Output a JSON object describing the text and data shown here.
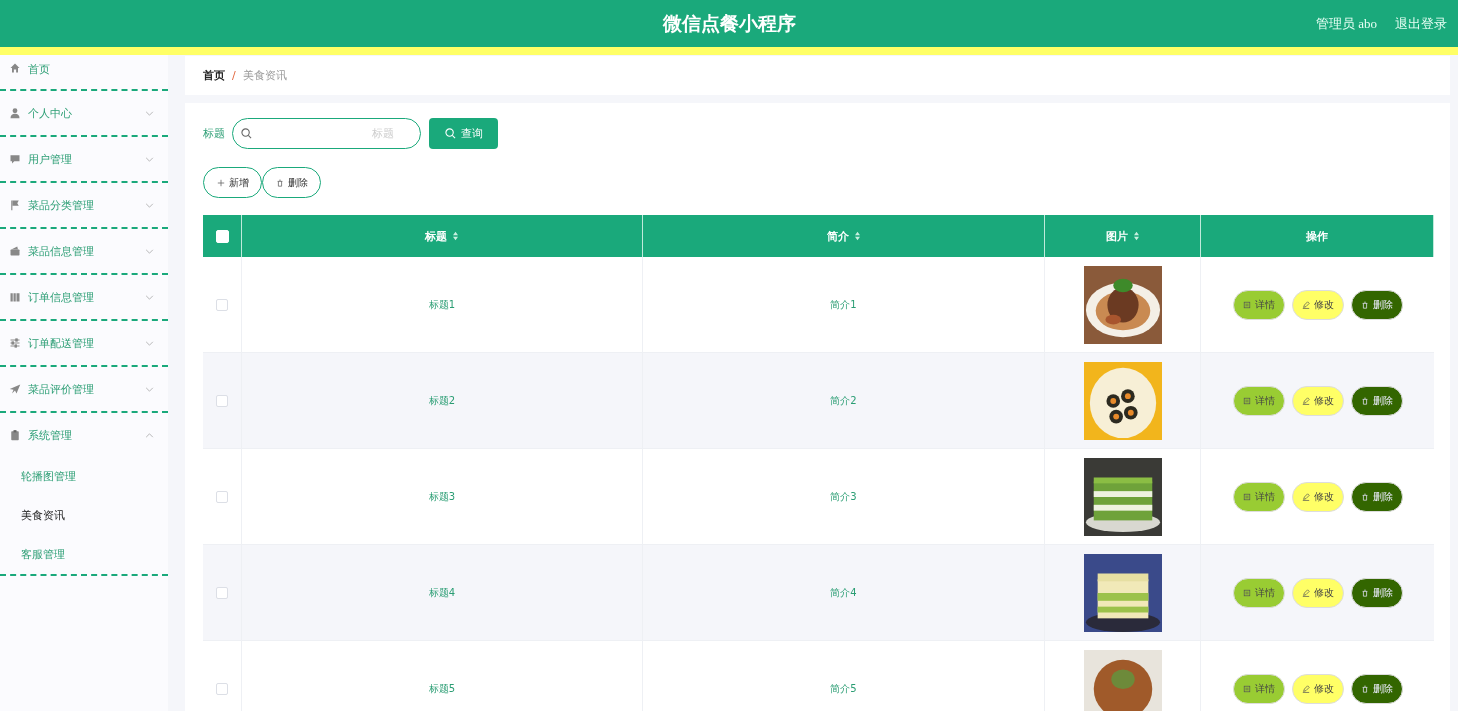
{
  "header": {
    "title": "微信点餐小程序",
    "user": "管理员 abo",
    "logout": "退出登录"
  },
  "sidebar": {
    "items": [
      {
        "label": "首页",
        "kind": "link"
      },
      {
        "label": "个人中心",
        "kind": "menu",
        "expanded": false
      },
      {
        "label": "用户管理",
        "kind": "menu",
        "expanded": false
      },
      {
        "label": "菜品分类管理",
        "kind": "menu",
        "expanded": false
      },
      {
        "label": "菜品信息管理",
        "kind": "menu",
        "expanded": false
      },
      {
        "label": "订单信息管理",
        "kind": "menu",
        "expanded": false
      },
      {
        "label": "订单配送管理",
        "kind": "menu",
        "expanded": false
      },
      {
        "label": "菜品评价管理",
        "kind": "menu",
        "expanded": false
      },
      {
        "label": "系统管理",
        "kind": "menu",
        "expanded": true,
        "children": [
          {
            "label": "轮播图管理",
            "selected": false
          },
          {
            "label": "美食资讯",
            "selected": true
          },
          {
            "label": "客服管理",
            "selected": false
          }
        ]
      }
    ]
  },
  "breadcrumb": {
    "items": [
      "首页",
      "美食资讯"
    ],
    "separator": "/"
  },
  "search": {
    "label": "标题",
    "placeholder": "标题",
    "button": "查询"
  },
  "actions": [
    "新增",
    "删除"
  ],
  "table": {
    "select_all_checked": false,
    "columns": [
      {
        "label": "标题",
        "sortable": true
      },
      {
        "label": "简介",
        "sortable": true
      },
      {
        "label": "图片",
        "sortable": true
      },
      {
        "label": "操作",
        "sortable": false
      }
    ],
    "rows": [
      {
        "checked": false,
        "title": "标题1",
        "intro": "简介1",
        "picture": {
          "kind": "picture"
        },
        "actions": [
          "详情",
          "修改",
          "删除"
        ]
      },
      {
        "checked": false,
        "title": "标题2",
        "intro": "简介2",
        "picture": {
          "kind": "picture"
        },
        "actions": [
          "详情",
          "修改",
          "删除"
        ]
      },
      {
        "checked": false,
        "title": "标题3",
        "intro": "简介3",
        "picture": {
          "kind": "picture"
        },
        "actions": [
          "详情",
          "修改",
          "删除"
        ]
      },
      {
        "checked": false,
        "title": "标题4",
        "intro": "简介4",
        "picture": {
          "kind": "picture"
        },
        "actions": [
          "详情",
          "修改",
          "删除"
        ]
      },
      {
        "checked": false,
        "title": "标题5",
        "intro": "简介5",
        "picture": {
          "kind": "picture"
        },
        "actions": [
          "详情",
          "修改",
          "删除"
        ]
      }
    ]
  }
}
